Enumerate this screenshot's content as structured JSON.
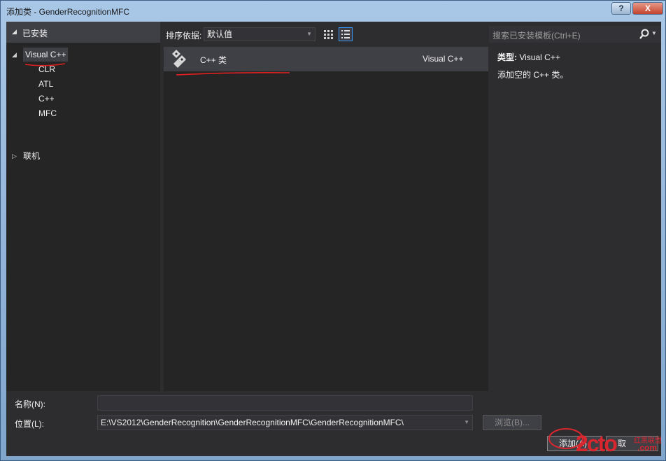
{
  "window": {
    "title": "添加类 - GenderRecognitionMFC",
    "help_label": "?",
    "close_label": "X"
  },
  "left_panel": {
    "header": "已安装",
    "tree": [
      {
        "label": "Visual C++",
        "expanded": true,
        "selected": true,
        "children": [
          "CLR",
          "ATL",
          "C++",
          "MFC"
        ]
      },
      {
        "label": "联机",
        "expanded": false
      }
    ]
  },
  "toolbar": {
    "sort_label": "排序依据:",
    "sort_value": "默认值"
  },
  "templates": [
    {
      "name": "C++ 类",
      "type": "Visual C++",
      "icon": "cpp-class-icon",
      "selected": true
    }
  ],
  "search": {
    "placeholder": "搜索已安装模板(Ctrl+E)"
  },
  "detail": {
    "type_key": "类型:",
    "type_value": "Visual C++",
    "description": "添加空的 C++ 类。"
  },
  "form": {
    "name_label": "名称(N):",
    "name_value": "",
    "location_label": "位置(L):",
    "location_value": "E:\\VS2012\\GenderRecognition\\GenderRecognitionMFC\\GenderRecognitionMFC\\"
  },
  "buttons": {
    "browse": "浏览(B)...",
    "add": "添加(A)",
    "cancel": "取"
  },
  "watermark": {
    "text": "2cto",
    "suffix": ".com",
    "cn": "红黑联盟"
  },
  "colors": {
    "background": "#2d2d30",
    "panel": "#252526",
    "selection": "#3f3f46",
    "focus": "#3399ff",
    "annotation": "#e02020"
  }
}
